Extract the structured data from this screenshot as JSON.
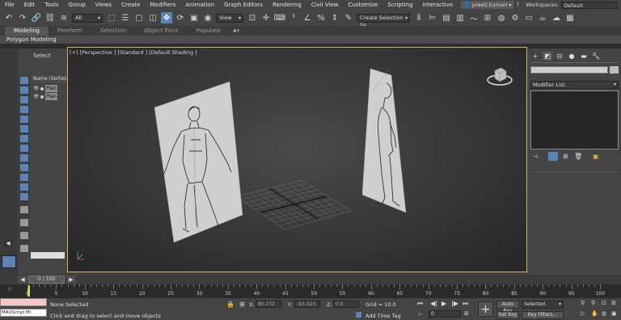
{
  "menubar": {
    "items": [
      "File",
      "Edit",
      "Tools",
      "Group",
      "Views",
      "Create",
      "Modifiers",
      "Animation",
      "Graph Editors",
      "Rendering",
      "Civil View",
      "Customize",
      "Scripting",
      "Interactive"
    ],
    "user": "preeti kumari",
    "workspaces_label": "Workspaces:",
    "workspace": "Default"
  },
  "toolbar": {
    "filter_dropdown": "All",
    "refcoord_dropdown": "View",
    "selection_set": "Create Selection Se"
  },
  "ribbon": {
    "tabs": [
      "Modeling",
      "Freeform",
      "Selection",
      "Object Paint",
      "Populate"
    ],
    "active_tab": "Modeling",
    "sub_label": "Polygon Modeling"
  },
  "explorer": {
    "select_label": "Select",
    "header": "Name (Sorted A",
    "rows": [
      {
        "name": "Plan"
      },
      {
        "name": "Plan"
      }
    ]
  },
  "viewport": {
    "label": "[+] [Perspective ] [Standard ] [Default Shading ]"
  },
  "command_panel": {
    "modifier_list": "Modifier List"
  },
  "timeslider": {
    "frame_range": "0 / 100"
  },
  "trackbar": {
    "ticks": [
      "0",
      "5",
      "10",
      "15",
      "20",
      "25",
      "30",
      "35",
      "40",
      "45",
      "50",
      "55",
      "60",
      "65",
      "70",
      "75",
      "80",
      "85",
      "90",
      "95",
      "100"
    ]
  },
  "status": {
    "maxscript": "MAXScript Mi",
    "selection": "None Selected",
    "prompt": "Click and drag to select and move objects",
    "x_label": "X:",
    "x_value": "80.272",
    "y_label": "Y:",
    "y_value": "-93.023",
    "z_label": "Z:",
    "z_value": "0.0",
    "grid": "Grid = 10.0",
    "add_time_tag": "Add Time Tag",
    "frame_value": "0",
    "auto_key": "Auto Key",
    "set_key": "Set Key",
    "key_mode": "Selected",
    "key_filters": "Key Filters..."
  }
}
